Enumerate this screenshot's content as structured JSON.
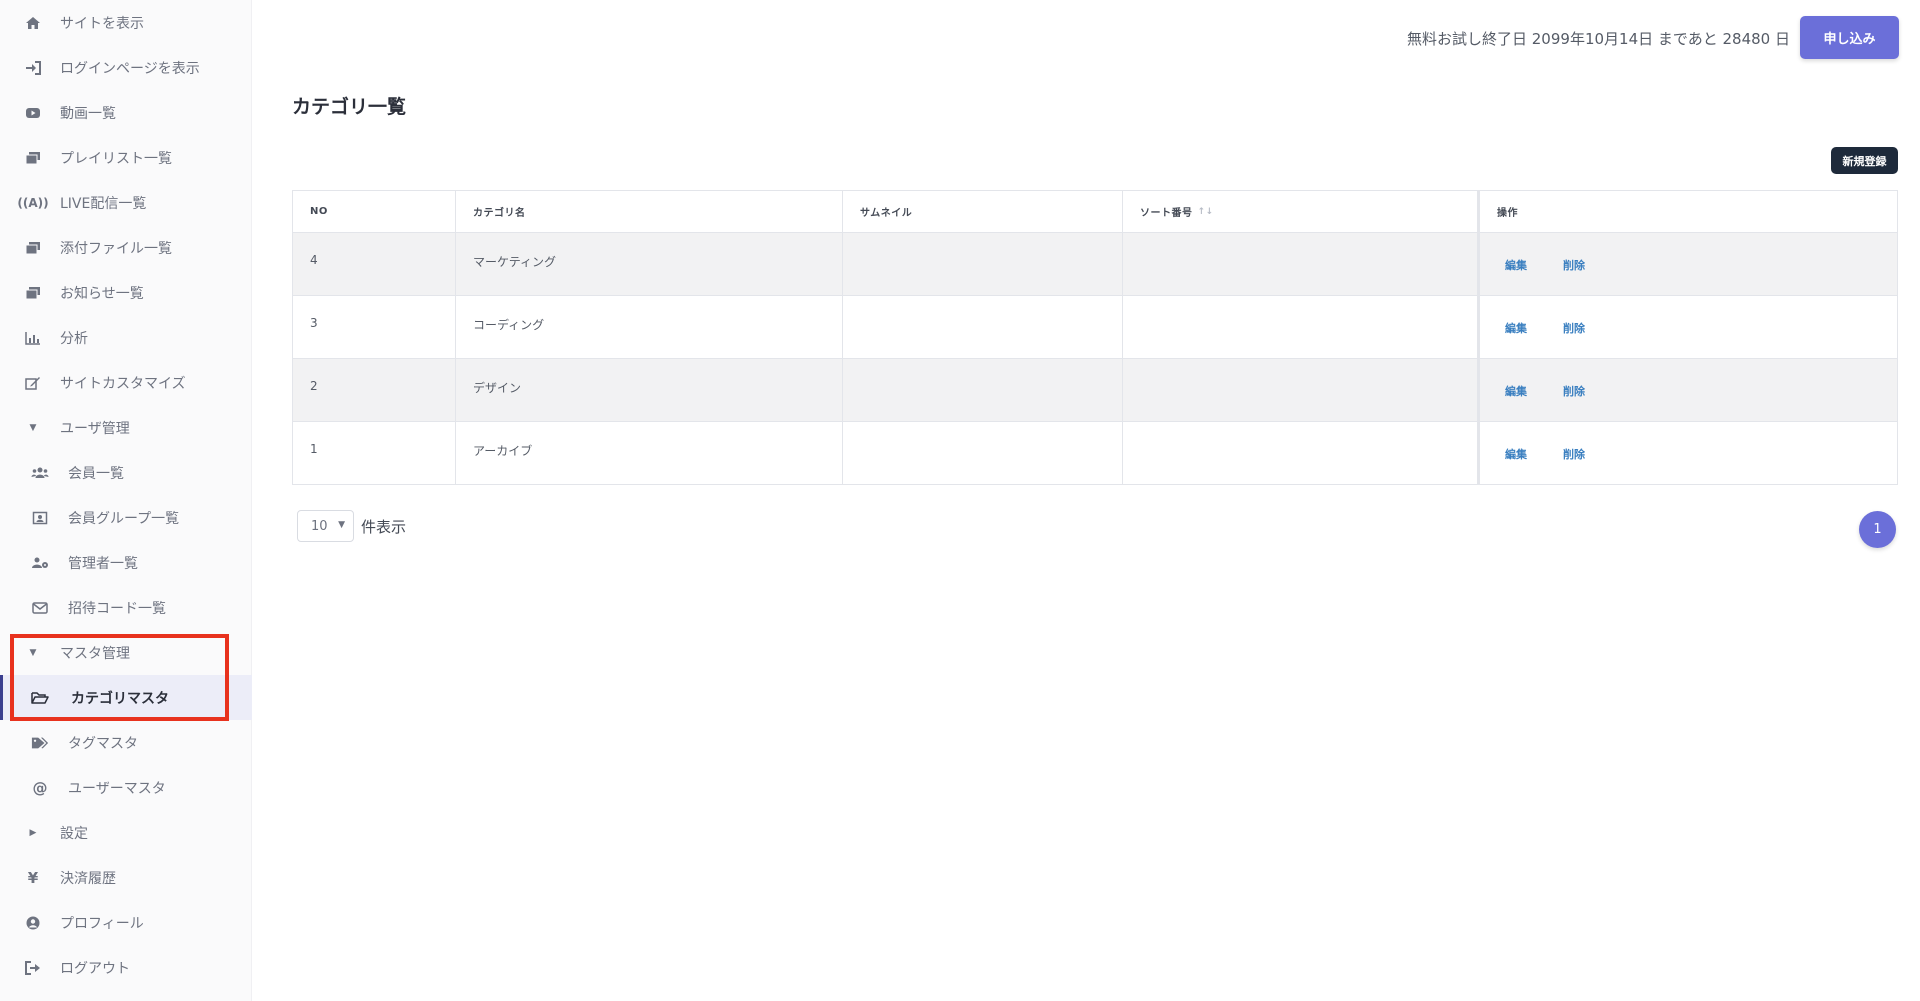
{
  "sidebar": {
    "items": [
      {
        "label": "サイトを表示",
        "icon": "home-icon"
      },
      {
        "label": "ログインページを表示",
        "icon": "sign-in-icon"
      },
      {
        "label": "動画一覧",
        "icon": "video-icon"
      },
      {
        "label": "プレイリスト一覧",
        "icon": "playlist-icon"
      },
      {
        "label": "LIVE配信一覧",
        "icon": "broadcast-icon"
      },
      {
        "label": "添付ファイル一覧",
        "icon": "attachment-icon"
      },
      {
        "label": "お知らせ一覧",
        "icon": "news-icon"
      },
      {
        "label": "分析",
        "icon": "bar-chart-icon"
      },
      {
        "label": "サイトカスタマイズ",
        "icon": "edit-icon"
      },
      {
        "label": "ユーザ管理",
        "icon": "caret-down-icon"
      },
      {
        "label": "会員一覧",
        "icon": "users-icon"
      },
      {
        "label": "会員グループ一覧",
        "icon": "group-icon"
      },
      {
        "label": "管理者一覧",
        "icon": "admin-icon"
      },
      {
        "label": "招待コード一覧",
        "icon": "envelope-icon"
      },
      {
        "label": "マスタ管理",
        "icon": "caret-down-icon"
      },
      {
        "label": "カテゴリマスタ",
        "icon": "folder-open-icon"
      },
      {
        "label": "タグマスタ",
        "icon": "tags-icon"
      },
      {
        "label": "ユーザーマスタ",
        "icon": "at-icon"
      },
      {
        "label": "設定",
        "icon": "caret-right-icon"
      },
      {
        "label": "決済履歴",
        "icon": "yen-icon"
      },
      {
        "label": "プロフィール",
        "icon": "user-circle-icon"
      },
      {
        "label": "ログアウト",
        "icon": "sign-out-icon"
      }
    ]
  },
  "header": {
    "trial_text": "無料お試し終了日 2099年10月14日 まであと 28480 日",
    "apply_label": "申し込み"
  },
  "page": {
    "title": "カテゴリ一覧",
    "new_label": "新規登録"
  },
  "table": {
    "columns": [
      "NO",
      "カテゴリ名",
      "サムネイル",
      "ソート番号",
      "操作"
    ],
    "sort_icon": "↑↓",
    "rows": [
      {
        "no": "4",
        "name": "マーケティング",
        "thumbnail": "",
        "sort": "",
        "edit": "編集",
        "delete": "削除"
      },
      {
        "no": "3",
        "name": "コーディング",
        "thumbnail": "",
        "sort": "",
        "edit": "編集",
        "delete": "削除"
      },
      {
        "no": "2",
        "name": "デザイン",
        "thumbnail": "",
        "sort": "",
        "edit": "編集",
        "delete": "削除"
      },
      {
        "no": "1",
        "name": "アーカイブ",
        "thumbnail": "",
        "sort": "",
        "edit": "編集",
        "delete": "削除"
      }
    ]
  },
  "pagination": {
    "per_page_value": "10",
    "per_page_label": "件表示",
    "current_page": "1"
  },
  "colors": {
    "accent": "#6b6fd9",
    "dark_button": "#1e2a3b",
    "highlight": "#e8321e",
    "link": "#3a7fc0"
  }
}
